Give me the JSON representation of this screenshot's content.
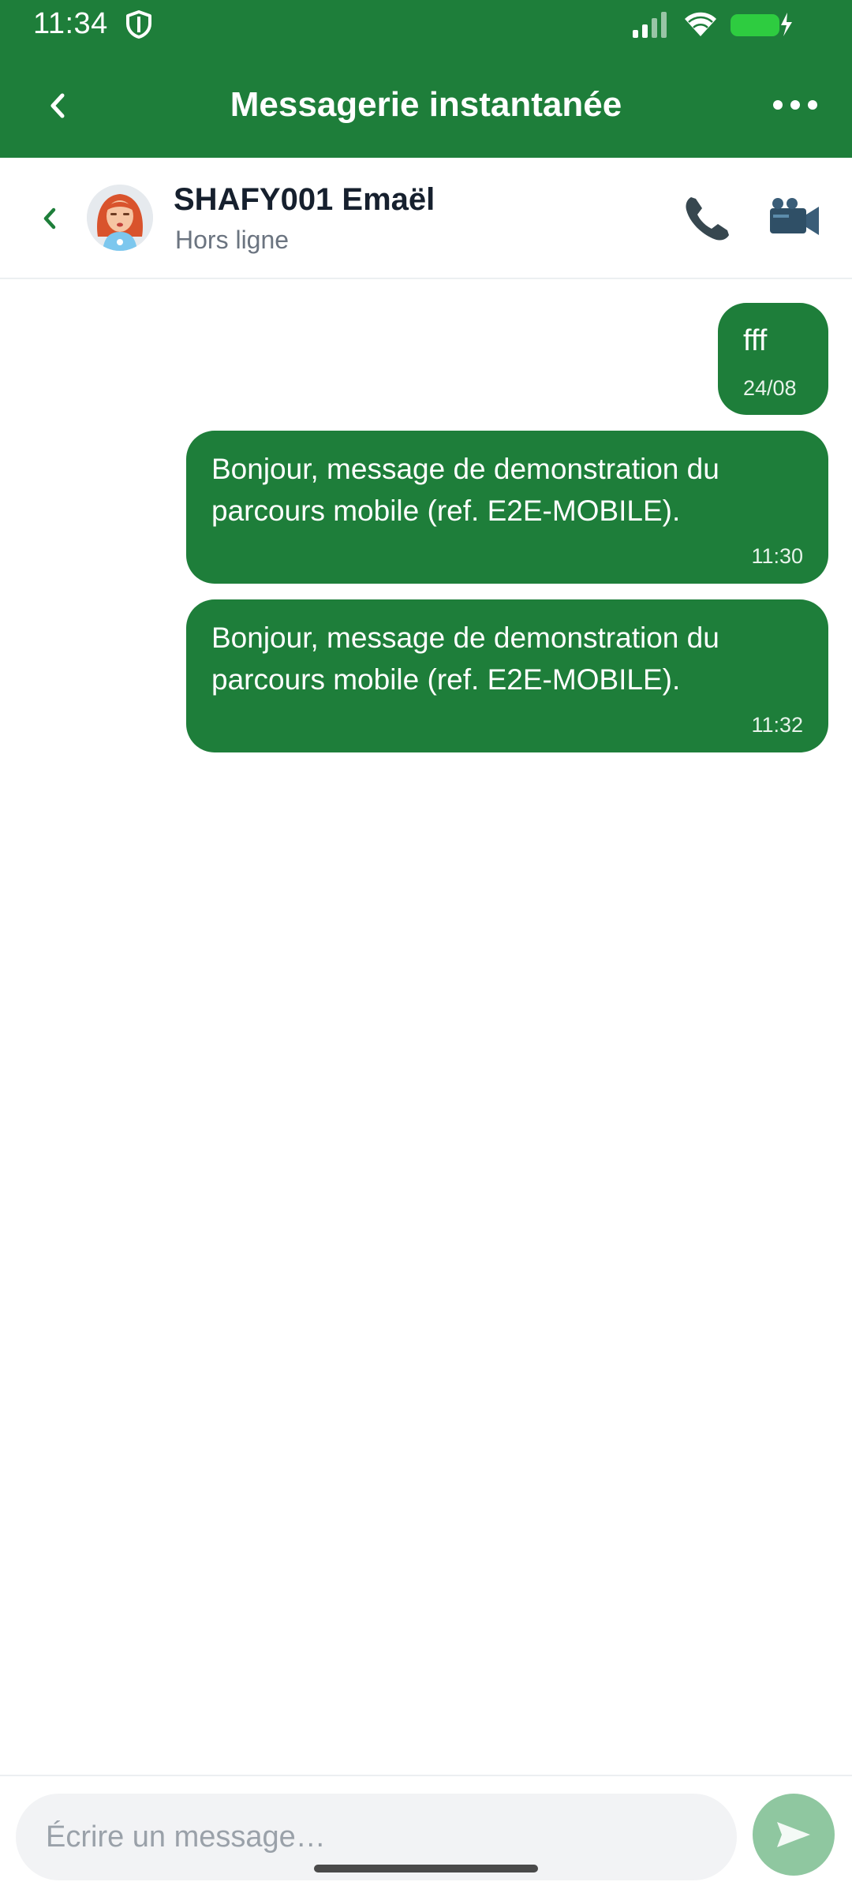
{
  "status_bar": {
    "time": "11:34",
    "icons": [
      "shield-icon",
      "signal-icon",
      "wifi-icon",
      "battery-charging-icon"
    ]
  },
  "app_bar": {
    "title": "Messagerie instantanée",
    "back_icon": "chevron-left-icon",
    "more_icon": "more-horizontal-icon"
  },
  "contact": {
    "name": "SHAFY001 Emaël",
    "status": "Hors ligne",
    "actions": [
      "phone-icon",
      "video-camera-icon"
    ]
  },
  "messages": [
    {
      "text": "fff",
      "time": "24/08",
      "direction": "outgoing"
    },
    {
      "text": "Bonjour, message de demonstration du parcours mobile (ref. E2E-MOBILE).",
      "time": "11:30",
      "direction": "outgoing"
    },
    {
      "text": "Bonjour, message de demonstration du parcours mobile (ref. E2E-MOBILE).",
      "time": "11:32",
      "direction": "outgoing"
    }
  ],
  "composer": {
    "placeholder": "Écrire un message…",
    "value": "",
    "send_icon": "send-icon"
  },
  "colors": {
    "brand": "#1e7e3a",
    "send_disabled": "#8fc7a0",
    "input_bg": "#f2f3f5",
    "status_text": "#6b7480"
  }
}
